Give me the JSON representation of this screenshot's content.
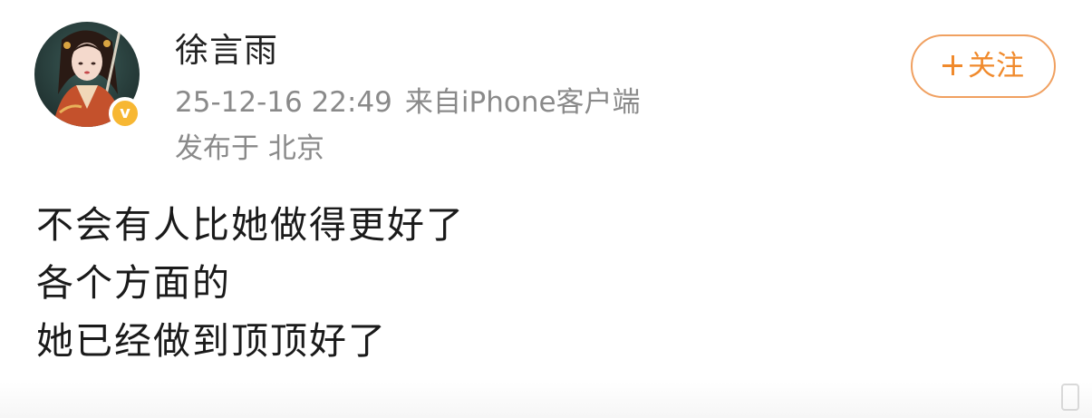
{
  "post": {
    "author": {
      "name": "徐言雨",
      "verified_badge": "v",
      "badge_color": "#f7b733"
    },
    "meta": {
      "timestamp": "25-12-16 22:49",
      "source": "来自iPhone客户端",
      "location": "发布于 北京"
    },
    "follow_button": {
      "label": "关注",
      "icon": "plus-icon",
      "color": "#f08a2c"
    },
    "content_lines": [
      "不会有人比她做得更好了",
      "各个方面的",
      "她已经做到顶顶好了"
    ]
  }
}
